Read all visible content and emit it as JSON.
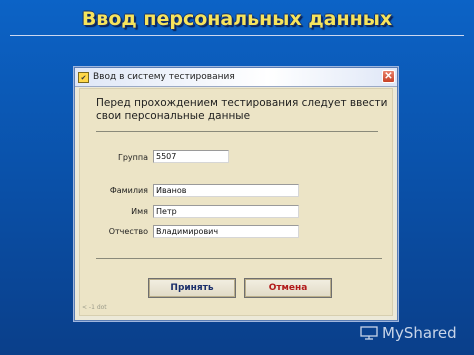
{
  "slide": {
    "title": "Ввод персональных данных",
    "footer_brand": "MyShared"
  },
  "dialog": {
    "title": "Ввод в систему тестирования",
    "close_symbol": "✕",
    "intro_line1": "Перед прохождением тестирования следует ввести",
    "intro_line2": "свои персональные данные",
    "fields": {
      "group": {
        "label": "Группа",
        "value": "5507"
      },
      "surname": {
        "label": "Фамилия",
        "value": "Иванов"
      },
      "name": {
        "label": "Имя",
        "value": "Петр"
      },
      "patronymic": {
        "label": "Отчество",
        "value": "Владимирович"
      }
    },
    "buttons": {
      "accept": "Принять",
      "cancel": "Отмена"
    },
    "status_text": "< -1 dot"
  },
  "colors": {
    "slide_background": "#0b57b4",
    "title_text": "#f6e45c",
    "dialog_panel": "#ece4c6",
    "accept_text": "#1b2f6b",
    "cancel_text": "#b21b1b"
  },
  "icons": {
    "app": "app-icon",
    "close": "close-icon",
    "footer": "presentation-screen-icon"
  }
}
